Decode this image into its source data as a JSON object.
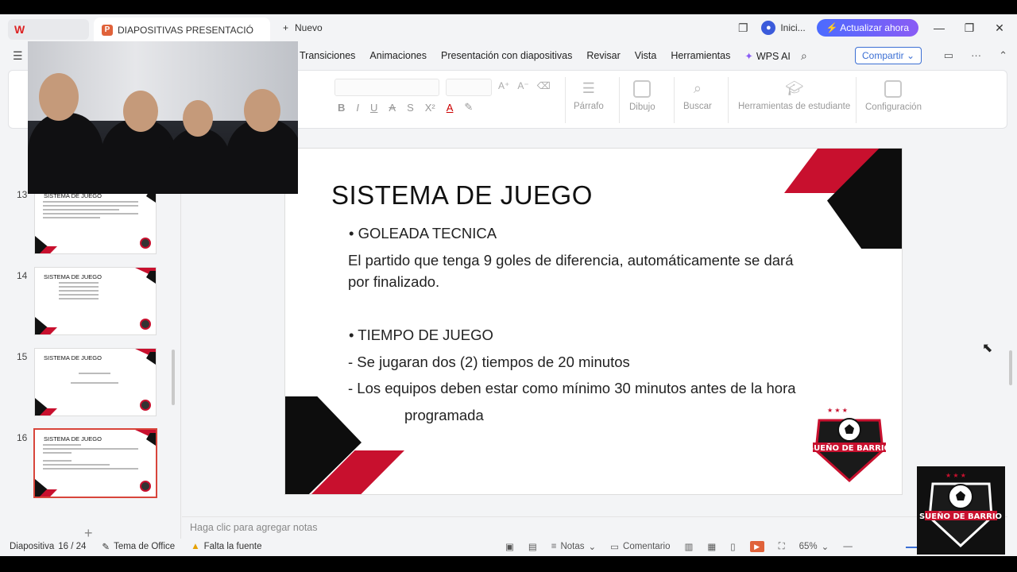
{
  "titlebar": {
    "app_label": "W",
    "doc_tab": "DIAPOSITIVAS PRESENTACIÓ",
    "new_tab": "Nuevo",
    "login": "Inici...",
    "upgrade": "Actualizar ahora"
  },
  "menu": {
    "items": [
      "Transiciones",
      "Animaciones",
      "Presentación con diapositivas",
      "Revisar",
      "Vista",
      "Herramientas"
    ],
    "wps_ai": "WPS AI",
    "share": "Compartir"
  },
  "ribbon": {
    "groups": [
      "Párrafo",
      "Dibujo",
      "Buscar",
      "Herramientas de estudiante",
      "Configuración"
    ]
  },
  "thumbnails": [
    {
      "num": "13",
      "title": "SISTEMA DE JUEGO"
    },
    {
      "num": "14",
      "title": "SISTEMA DE JUEGO"
    },
    {
      "num": "15",
      "title": "SISTEMA DE JUEGO"
    },
    {
      "num": "16",
      "title": "SISTEMA DE JUEGO"
    }
  ],
  "slide": {
    "title": "SISTEMA DE JUEGO",
    "bullet1": "• GOLEADA TECNICA",
    "para1_line1": "El partido que tenga 9 goles de diferencia, automáticamente se dará",
    "para1_line2": "por finalizado.",
    "bullet2": "• TIEMPO DE JUEGO",
    "item1": "- Se jugaran dos (2) tiempos de 20 minutos",
    "item2_line1": "- Los equipos deben estar como mínimo 30 minutos antes de la hora",
    "item2_line2": "programada",
    "logo_text": "SUEÑO DE BARRIO"
  },
  "notes": {
    "placeholder": "Haga clic para agregar notas"
  },
  "status": {
    "slide_label": "Diapositiva",
    "slide_pos": "16 / 24",
    "theme": "Tema de Office",
    "missing_font": "Falta la fuente",
    "notes": "Notas",
    "comment": "Comentario",
    "zoom": "65%"
  },
  "corner_logo_text": "SUEÑO DE BARRIO",
  "colors": {
    "accent_red": "#c8102e",
    "accent_black": "#0d0d0d",
    "upgrade_blue": "#4b6bff"
  }
}
